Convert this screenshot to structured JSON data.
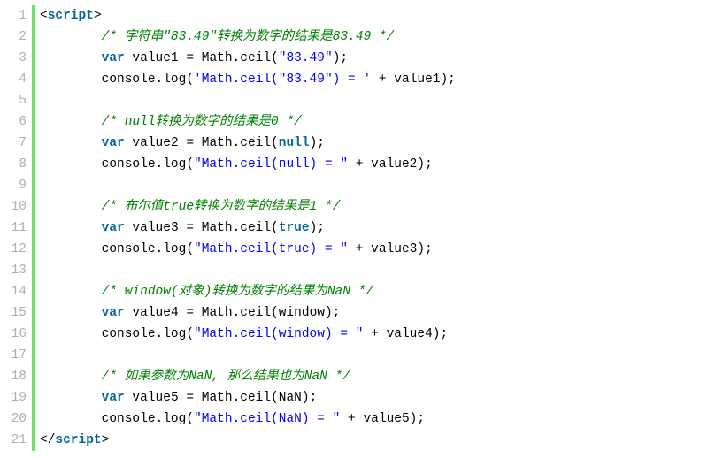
{
  "lineCount": 21,
  "tokens": {
    "l1": [
      [
        "punct",
        "<"
      ],
      [
        "tag",
        "script"
      ],
      [
        "punct",
        ">"
      ]
    ],
    "l2": [
      [
        "ident",
        "        "
      ],
      [
        "cmt",
        "/* 字符串\"83.49\"转换为数字的结果是83.49 */"
      ]
    ],
    "l3": [
      [
        "ident",
        "        "
      ],
      [
        "kw",
        "var"
      ],
      [
        "ident",
        " value1 = Math.ceil("
      ],
      [
        "str",
        "\"83.49\""
      ],
      [
        "ident",
        ");"
      ]
    ],
    "l4": [
      [
        "ident",
        "        console.log("
      ],
      [
        "str",
        "'Math.ceil(\"83.49\") = '"
      ],
      [
        "ident",
        " + value1);"
      ]
    ],
    "l5": [
      [
        "ident",
        " "
      ]
    ],
    "l6": [
      [
        "ident",
        "        "
      ],
      [
        "cmt",
        "/* null转换为数字的结果是0 */"
      ]
    ],
    "l7": [
      [
        "ident",
        "        "
      ],
      [
        "kw",
        "var"
      ],
      [
        "ident",
        " value2 = Math.ceil("
      ],
      [
        "bool",
        "null"
      ],
      [
        "ident",
        ");"
      ]
    ],
    "l8": [
      [
        "ident",
        "        console.log("
      ],
      [
        "str",
        "\"Math.ceil(null) = \""
      ],
      [
        "ident",
        " + value2);"
      ]
    ],
    "l9": [
      [
        "ident",
        " "
      ]
    ],
    "l10": [
      [
        "ident",
        "        "
      ],
      [
        "cmt",
        "/* 布尔值true转换为数字的结果是1 */"
      ]
    ],
    "l11": [
      [
        "ident",
        "        "
      ],
      [
        "kw",
        "var"
      ],
      [
        "ident",
        " value3 = Math.ceil("
      ],
      [
        "bool",
        "true"
      ],
      [
        "ident",
        ");"
      ]
    ],
    "l12": [
      [
        "ident",
        "        console.log("
      ],
      [
        "str",
        "\"Math.ceil(true) = \""
      ],
      [
        "ident",
        " + value3);"
      ]
    ],
    "l13": [
      [
        "ident",
        " "
      ]
    ],
    "l14": [
      [
        "ident",
        "        "
      ],
      [
        "cmt",
        "/* window(对象)转换为数字的结果为NaN */"
      ]
    ],
    "l15": [
      [
        "ident",
        "        "
      ],
      [
        "kw",
        "var"
      ],
      [
        "ident",
        " value4 = Math.ceil(window);"
      ]
    ],
    "l16": [
      [
        "ident",
        "        console.log("
      ],
      [
        "str",
        "\"Math.ceil(window) = \""
      ],
      [
        "ident",
        " + value4);"
      ]
    ],
    "l17": [
      [
        "ident",
        " "
      ]
    ],
    "l18": [
      [
        "ident",
        "        "
      ],
      [
        "cmt",
        "/* 如果参数为NaN, 那么结果也为NaN */"
      ]
    ],
    "l19": [
      [
        "ident",
        "        "
      ],
      [
        "kw",
        "var"
      ],
      [
        "ident",
        " value5 = Math.ceil(NaN);"
      ]
    ],
    "l20": [
      [
        "ident",
        "        console.log("
      ],
      [
        "str",
        "\"Math.ceil(NaN) = \""
      ],
      [
        "ident",
        " + value5);"
      ]
    ],
    "l21": [
      [
        "punct",
        "</"
      ],
      [
        "tag",
        "script"
      ],
      [
        "punct",
        ">"
      ]
    ]
  }
}
